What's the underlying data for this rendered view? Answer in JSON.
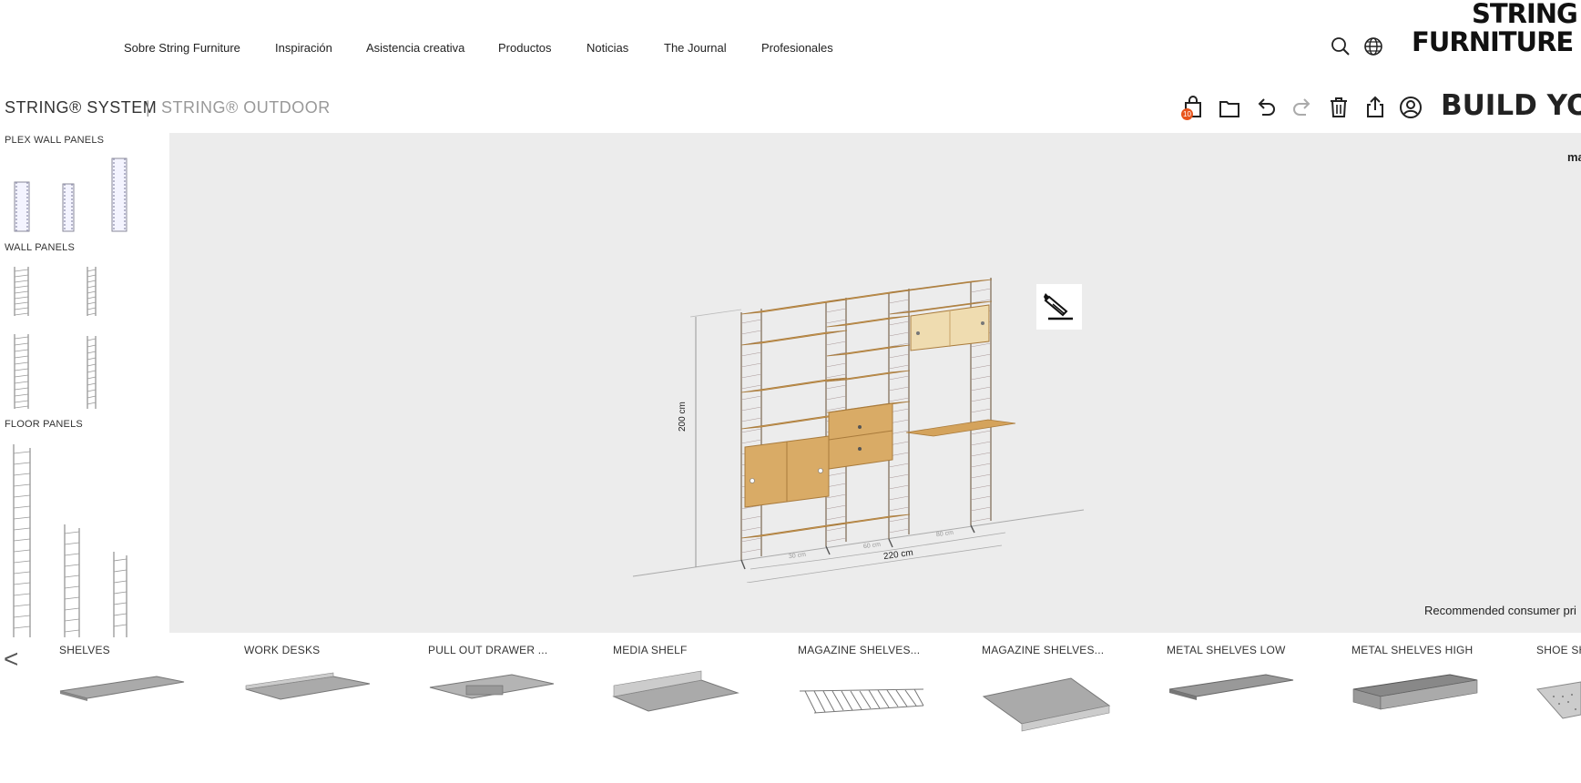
{
  "nav": {
    "items": [
      "Sobre String Furniture",
      "Inspiración",
      "Asistencia creativa",
      "Productos",
      "Noticias",
      "The Journal",
      "Profesionales"
    ],
    "logo_line1": "STRING",
    "logo_line2": "FURNITURE"
  },
  "subheader": {
    "tab_system": "STRING® SYSTEM",
    "divider": "|",
    "tab_outdoor": "STRING® OUTDOOR",
    "cart_count": "10",
    "build_title": "BUILD YOU"
  },
  "sidebar": {
    "plex_wall_panels": "PLEX WALL PANELS",
    "wall_panels": "WALL PANELS",
    "floor_panels": "FLOOR PANELS"
  },
  "canvas": {
    "dim_height": "200 cm",
    "dim_width": "220 cm",
    "dim_sec1": "30 cm",
    "dim_sec2": "60 cm",
    "dim_sec3": "80 cm",
    "top_right_text": "ma",
    "price_note": "Recommended consumer pri"
  },
  "products": {
    "prev": "<",
    "items": [
      "SHELVES",
      "WORK DESKS",
      "PULL OUT DRAWER ...",
      "MEDIA SHELF",
      "MAGAZINE SHELVES...",
      "MAGAZINE SHELVES...",
      "METAL SHELVES LOW",
      "METAL SHELVES HIGH",
      "SHOE SH"
    ]
  },
  "colors": {
    "accent_badge": "#e8541c",
    "canvas_bg": "#ececec",
    "wood": "#d4a35c"
  }
}
